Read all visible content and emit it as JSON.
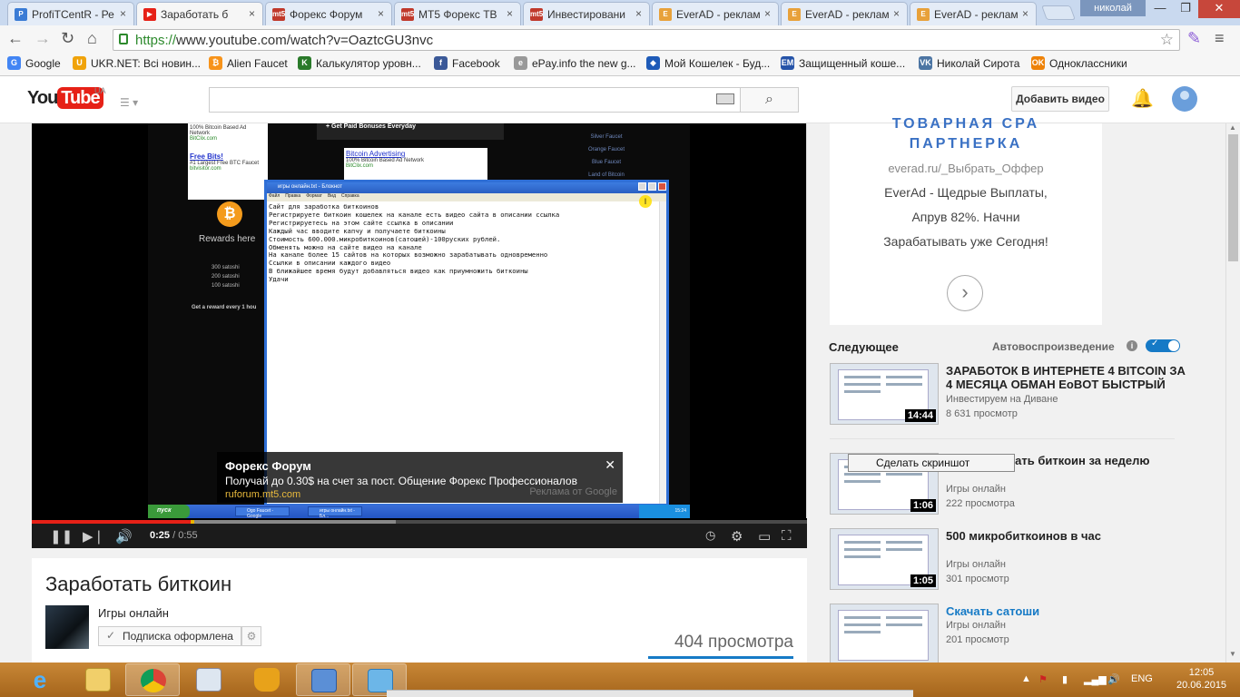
{
  "browser": {
    "tabs": [
      {
        "title": "ProfiTCentR - Ре",
        "fav": "P",
        "color": "#3a7bd5",
        "active": false
      },
      {
        "title": "Заработать б",
        "fav": "▶",
        "color": "#e62117",
        "active": true
      },
      {
        "title": "Форекс Форум",
        "fav": "mt5",
        "color": "#c0392b",
        "active": false
      },
      {
        "title": "MT5 Форекс ТВ",
        "fav": "mt5",
        "color": "#c0392b",
        "active": false
      },
      {
        "title": "Инвестировани",
        "fav": "mt5",
        "color": "#c0392b",
        "active": false
      },
      {
        "title": "EverAD - реклам",
        "fav": "E",
        "color": "#e8a13a",
        "active": false
      },
      {
        "title": "EverAD - реклам",
        "fav": "E",
        "color": "#e8a13a",
        "active": false
      },
      {
        "title": "EverAD - реклам",
        "fav": "E",
        "color": "#e8a13a",
        "active": false
      }
    ],
    "user": "николай",
    "url_scheme": "https://",
    "url_rest": "www.youtube.com/watch?v=OaztcGU3nvc",
    "bookmarks": [
      {
        "label": "Google",
        "color": "#4285f4",
        "ic": "G"
      },
      {
        "label": "UKR.NET: Всі новин...",
        "color": "#f0a30a",
        "ic": "U"
      },
      {
        "label": "Alien Faucet",
        "color": "#f7931a",
        "ic": "₿"
      },
      {
        "label": "Калькулятор уровн...",
        "color": "#2a7a2a",
        "ic": "K"
      },
      {
        "label": "Facebook",
        "color": "#3b5998",
        "ic": "f"
      },
      {
        "label": "ePay.info the new g...",
        "color": "#999999",
        "ic": "e"
      },
      {
        "label": "Мой Кошелек - Буд...",
        "color": "#1e5bb8",
        "ic": "◆"
      },
      {
        "label": "Защищенный коше...",
        "color": "#2553a8",
        "ic": "EM"
      },
      {
        "label": "Николай Сирота",
        "color": "#4c75a3",
        "ic": "VK"
      },
      {
        "label": "Одноклассники",
        "color": "#ee8208",
        "ic": "OK"
      }
    ]
  },
  "youtube": {
    "logo_you": "You",
    "logo_tube": "Tube",
    "region": "UA",
    "upload_label": "Добавить видео"
  },
  "video": {
    "screen": {
      "ad1_line1": "100% Bitcoin Based Ad Network",
      "ad1_line2": "BitClix.com",
      "ad1_title": "Free Bits!",
      "ad1_line3": "#1 Largest Free BTC Faucet",
      "ad1_line4": "bitvisitor.com",
      "topbar": "+ Get Paid Bonuses Everyday",
      "ad2_title": "Bitcoin Advertising",
      "ad2_line1": "100% Bitcoin Based Ad Network",
      "ad2_line2": "BitClix.com",
      "side_links": [
        "Silver Faucet",
        "Orange Faucet",
        "Blue Faucet",
        "Land of Bitcoin"
      ],
      "rewards": "Rewards here",
      "satoshi": [
        "300 satoshi",
        "200 satoshi",
        "100 satoshi"
      ],
      "get_reward": "Get a reward every 1 hou",
      "notepad_title": "игры онлайн.txt - Блокнот",
      "notepad_menu": [
        "Файл",
        "Правка",
        "Формат",
        "Вид",
        "Справка"
      ],
      "notepad_text": "Сайт для заработка биткоинов\nРегистрируете биткоин кошелек на канале есть видео сайта в описании ссылка\nРегистрируетесь на этом сайте ссылка в описании\nКаждый час вводите капчу и получаете биткоины\nСтоимость 600.000.микробиткоинов(сатошей)-100руских рублей.\nОбменять можно на сайте видео на канале\nНа канале более 15 сайтов на которых возможно зарабатывать одновременно\nСсылки в описании каждого видео\nВ ближайшее время будут добавляться видео как приумножить биткоины\nУдачи",
      "xp_start": "пуск",
      "xp_items": [
        "Ogo Faucet - Google",
        "игры онлайн.txt - Бл..."
      ],
      "xp_time": "15:24"
    },
    "ad_overlay": {
      "title": "Форекс Форум",
      "text": "Получай до 0.30$ на счет за пост. Общение Форекс Профессионалов",
      "link": "ruforum.mt5.com",
      "by": "Реклама от Google",
      "close": "✕"
    },
    "current_time": "0:25",
    "separator": " / ",
    "duration": "0:55",
    "played_fraction": 0.4545,
    "buffered_fraction": 0.47,
    "title": "Заработать биткоин",
    "channel": "Игры онлайн",
    "subscribe_label": "Подписка оформлена",
    "views": "404 просмотра"
  },
  "sidebar": {
    "ad": {
      "head_line1": "ТОВАРНАЯ CPA",
      "head_line2": "ПАРТНЕРКА",
      "domain": "everad.ru/_Выбрать_Оффер",
      "line1": "EverAd - Щедрые Выплаты,",
      "line2": "Апрув 82%. Начни",
      "line3": "Зарабатывать уже Сегодня!"
    },
    "up_next": "Следующее",
    "autoplay": "Автовоспроизведение",
    "autoplay_on": true,
    "items": [
      {
        "title": "ЗАРАБОТОК В ИНТЕРНЕТЕ 4 BITCOIN ЗА 4 МЕСЯЦА ОБМАН EoBOT БЫСТРЫЙ",
        "channel": "Инвестируем на Диване",
        "views": "8 631 просмотр",
        "duration": "14:44"
      },
      {
        "title": "Как заработать биткоин за неделю",
        "channel": "Игры онлайн",
        "views": "222 просмотра",
        "duration": "1:06"
      },
      {
        "title": "500 микробиткоинов в час",
        "channel": "Игры онлайн",
        "views": "301 просмотр",
        "duration": "1:05"
      },
      {
        "title": "Скачать сатоши",
        "channel": "Игры онлайн",
        "views": "201 просмотр",
        "duration": ""
      }
    ],
    "tooltip": "Сделать скриншот"
  },
  "taskbar": {
    "lang": "ENG",
    "time": "12:05",
    "date": "20.06.2015"
  }
}
